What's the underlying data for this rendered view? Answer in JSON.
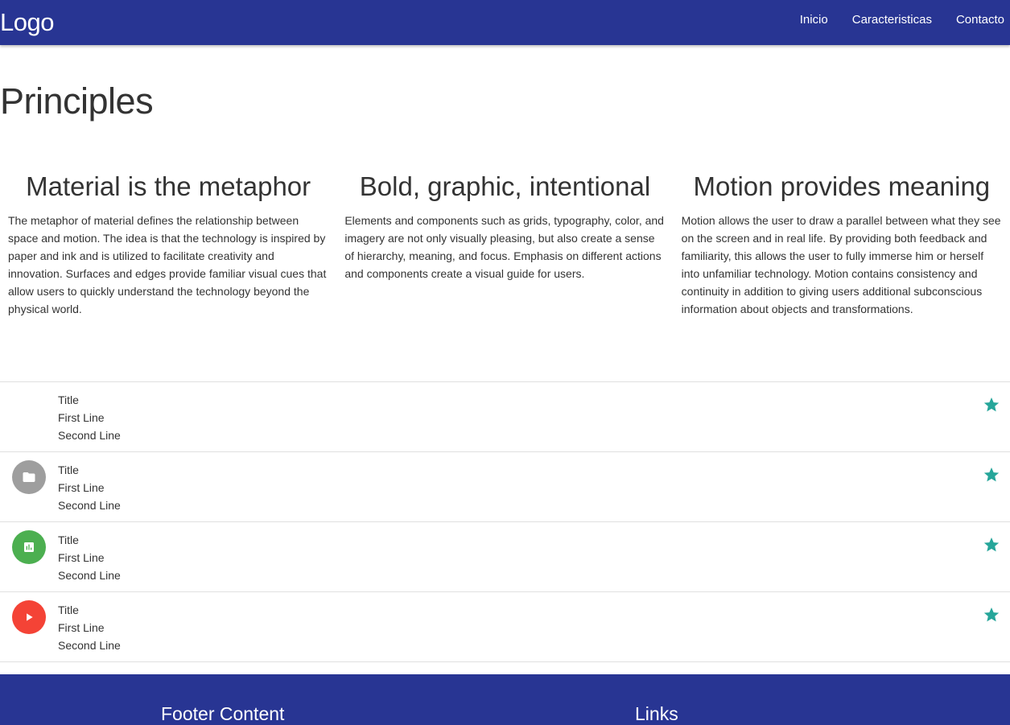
{
  "navbar": {
    "logo": "Logo",
    "links": [
      "Inicio",
      "Caracteristicas",
      "Contacto"
    ]
  },
  "page": {
    "title": "Principles"
  },
  "columns": [
    {
      "heading": "Material is the metaphor",
      "text": "The metaphor of material defines the relationship between space and motion. The idea is that the technology is inspired by paper and ink and is utilized to facilitate creativity and innovation. Surfaces and edges provide familiar visual cues that allow users to quickly understand the technology beyond the physical world."
    },
    {
      "heading": "Bold, graphic, intentional",
      "text": "Elements and components such as grids, typography, color, and imagery are not only visually pleasing, but also create a sense of hierarchy, meaning, and focus. Emphasis on different actions and components create a visual guide for users."
    },
    {
      "heading": "Motion provides meaning",
      "text": "Motion allows the user to draw a parallel between what they see on the screen and in real life. By providing both feedback and familiarity, this allows the user to fully immerse him or herself into unfamiliar technology. Motion contains consistency and continuity in addition to giving users additional subconscious information about objects and transformations."
    }
  ],
  "list": {
    "items": [
      {
        "title": "Title",
        "line1": "First Line",
        "line2": "Second Line",
        "icon": "none",
        "color": ""
      },
      {
        "title": "Title",
        "line1": "First Line",
        "line2": "Second Line",
        "icon": "folder-icon",
        "color": "#9e9e9e"
      },
      {
        "title": "Title",
        "line1": "First Line",
        "line2": "Second Line",
        "icon": "chart-icon",
        "color": "#4caf50"
      },
      {
        "title": "Title",
        "line1": "First Line",
        "line2": "Second Line",
        "icon": "play-icon",
        "color": "#f44336"
      }
    ],
    "star_color": "#26a69a",
    "star_icon": "star-icon"
  },
  "footer": {
    "left_title": "Footer Content",
    "right_title": "Links"
  },
  "colors": {
    "primary": "#283593"
  }
}
